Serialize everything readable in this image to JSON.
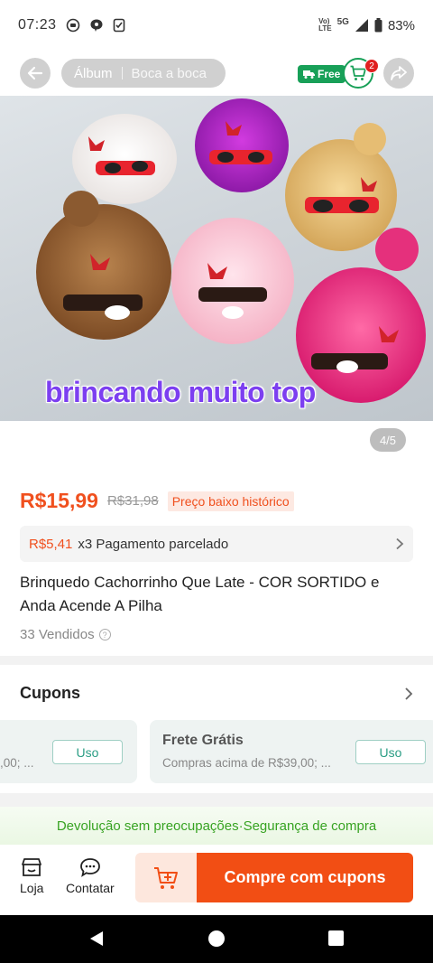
{
  "status_bar": {
    "time": "07:23",
    "carrier_top": "Vo)",
    "carrier_bottom": "LTE",
    "network": "5G",
    "battery": "83%"
  },
  "top_bar": {
    "tabs": [
      {
        "label": "Álbum",
        "active": true
      },
      {
        "label": "Boca a boca",
        "active": false
      }
    ],
    "free_badge": "Free",
    "cart_count": "2"
  },
  "gallery": {
    "overlay_text": "brincando muito top",
    "page_indicator": "4/5"
  },
  "product": {
    "price": "R$15,99",
    "original_price": "R$31,98",
    "price_badge": "Preço baixo histórico",
    "installment_amount": "R$5,41",
    "installment_text": "x3 Pagamento parcelado",
    "title": "Brinquedo Cachorrinho Que Late - COR SORTIDO e Anda Acende A Pilha",
    "sold": "33 Vendidos"
  },
  "coupons": {
    "heading": "Cupons",
    "items": [
      {
        "title": "",
        "subtitle": ",00; ...",
        "button": "Uso"
      },
      {
        "title": "Frete Grátis",
        "subtitle": "Compras acima de R$39,00; ...",
        "button": "Uso"
      }
    ]
  },
  "guarantee": "Devolução sem preocupações·Segurança de compra",
  "bottom_bar": {
    "store_label": "Loja",
    "contact_label": "Contatar",
    "buy_label": "Compre com cupons"
  },
  "colors": {
    "accent": "#f24e14",
    "price": "#f0501e",
    "free_badge": "#18a058",
    "guarantee_text": "#37a322",
    "overlay_text": "#7c3ff0"
  }
}
